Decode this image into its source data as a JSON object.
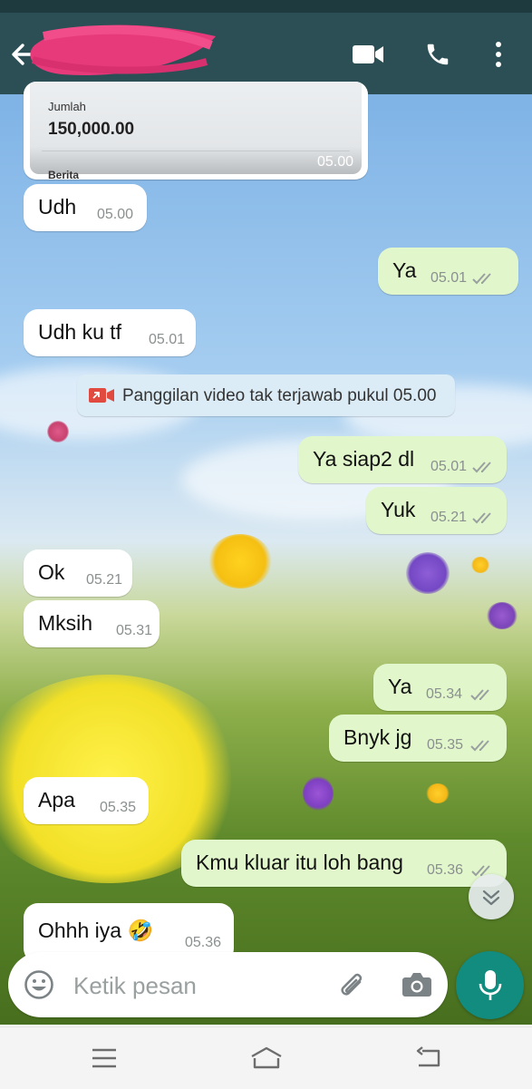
{
  "colors": {
    "header": "#2c4f56",
    "incoming_bubble": "#ffffff",
    "outgoing_bubble": "#e1f7cb",
    "mic_button": "#128c7e",
    "read_ticks": "#9aa0a0"
  },
  "header": {
    "icons": [
      "back-arrow-icon",
      "video-call-icon",
      "phone-icon",
      "more-options-icon"
    ]
  },
  "card": {
    "label": "Jumlah",
    "amount": "150,000.00",
    "label2": "Berita",
    "time": "05.00"
  },
  "notice": {
    "icon": "missed-video-call-icon",
    "text": "Panggilan video tak terjawab pukul 05.00"
  },
  "messages": [
    {
      "dir": "in",
      "text": "Udh",
      "time": "05.00"
    },
    {
      "dir": "out",
      "text": "Ya",
      "time": "05.01",
      "ticks": true
    },
    {
      "dir": "in",
      "text": "Udh ku tf",
      "time": "05.01"
    },
    {
      "dir": "out",
      "text": "Ya siap2 dl",
      "time": "05.01",
      "ticks": true
    },
    {
      "dir": "out",
      "text": "Yuk",
      "time": "05.21",
      "ticks": true
    },
    {
      "dir": "in",
      "text": "Ok",
      "time": "05.21"
    },
    {
      "dir": "in",
      "text": "Mksih",
      "time": "05.31"
    },
    {
      "dir": "out",
      "text": "Ya",
      "time": "05.34",
      "ticks": true
    },
    {
      "dir": "out",
      "text": "Bnyk jg",
      "time": "05.35",
      "ticks": true
    },
    {
      "dir": "in",
      "text": "Apa",
      "time": "05.35"
    },
    {
      "dir": "out",
      "text": "Kmu kluar itu loh bang",
      "time": "05.36",
      "ticks": true
    },
    {
      "dir": "in",
      "text": "Ohhh iya 🤣",
      "time": "05.36"
    }
  ],
  "composer": {
    "placeholder": "Ketik pesan",
    "value": ""
  },
  "navbar": {
    "icons": [
      "menu-icon",
      "home-icon",
      "back-icon"
    ]
  }
}
